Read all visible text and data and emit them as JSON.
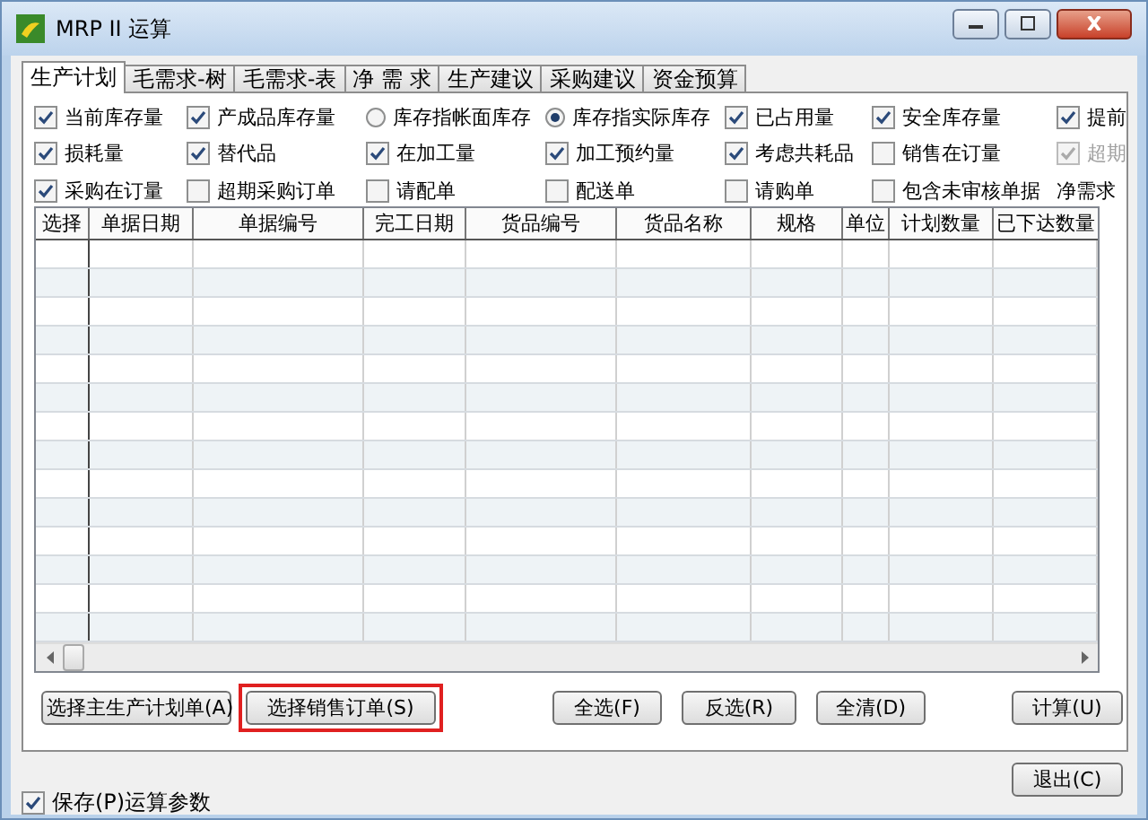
{
  "window": {
    "title": "MRP II 运算"
  },
  "tabs": [
    {
      "label": "生产计划",
      "selected": true
    },
    {
      "label": "毛需求-树",
      "selected": false
    },
    {
      "label": "毛需求-表",
      "selected": false
    },
    {
      "label": "净 需 求",
      "selected": false
    },
    {
      "label": "生产建议",
      "selected": false
    },
    {
      "label": "采购建议",
      "selected": false
    },
    {
      "label": "资金预算",
      "selected": false
    }
  ],
  "options": [
    {
      "kind": "checkbox",
      "label": "当前库存量",
      "checked": true,
      "disabled": false
    },
    {
      "kind": "checkbox",
      "label": "产成品库存量",
      "checked": true,
      "disabled": false
    },
    {
      "kind": "radio",
      "label": "库存指帐面库存",
      "checked": false,
      "disabled": false
    },
    {
      "kind": "radio",
      "label": "库存指实际库存",
      "checked": true,
      "disabled": false
    },
    {
      "kind": "checkbox",
      "label": "已占用量",
      "checked": true,
      "disabled": false
    },
    {
      "kind": "checkbox",
      "label": "安全库存量",
      "checked": true,
      "disabled": false
    },
    {
      "kind": "checkbox",
      "label": "提前",
      "checked": true,
      "disabled": false
    },
    {
      "kind": "checkbox",
      "label": "损耗量",
      "checked": true,
      "disabled": false
    },
    {
      "kind": "checkbox",
      "label": "替代品",
      "checked": true,
      "disabled": false
    },
    {
      "kind": "checkbox",
      "label": "在加工量",
      "checked": true,
      "disabled": false
    },
    {
      "kind": "checkbox",
      "label": "加工预约量",
      "checked": true,
      "disabled": false
    },
    {
      "kind": "checkbox",
      "label": "考虑共耗品",
      "checked": true,
      "disabled": false
    },
    {
      "kind": "checkbox",
      "label": "销售在订量",
      "checked": false,
      "disabled": false
    },
    {
      "kind": "checkbox",
      "label": "超期",
      "checked": true,
      "disabled": true
    },
    {
      "kind": "checkbox",
      "label": "采购在订量",
      "checked": true,
      "disabled": false
    },
    {
      "kind": "checkbox",
      "label": "超期采购订单",
      "checked": false,
      "disabled": false
    },
    {
      "kind": "checkbox",
      "label": "请配单",
      "checked": false,
      "disabled": false
    },
    {
      "kind": "checkbox",
      "label": "配送单",
      "checked": false,
      "disabled": false
    },
    {
      "kind": "checkbox",
      "label": "请购单",
      "checked": false,
      "disabled": false
    },
    {
      "kind": "checkbox",
      "label": "包含未审核单据",
      "checked": false,
      "disabled": false
    },
    {
      "kind": "text",
      "label": "净需求"
    }
  ],
  "table": {
    "columns": [
      "选择",
      "单据日期",
      "单据编号",
      "完工日期",
      "货品编号",
      "货品名称",
      "规格",
      "单位",
      "计划数量",
      "已下达数量"
    ]
  },
  "buttons": [
    {
      "label": "选择主生产计划单(A)",
      "highlighted": false
    },
    {
      "label": "选择销售订单(S)",
      "highlighted": true
    },
    {
      "label": "全选(F)",
      "highlighted": false
    },
    {
      "label": "反选(R)",
      "highlighted": false
    },
    {
      "label": "全清(D)",
      "highlighted": false
    },
    {
      "label": "计算(U)",
      "highlighted": false
    }
  ],
  "save_params": {
    "label": "保存(P)运算参数",
    "checked": true
  },
  "exit_button": {
    "label": "退出(C)"
  }
}
